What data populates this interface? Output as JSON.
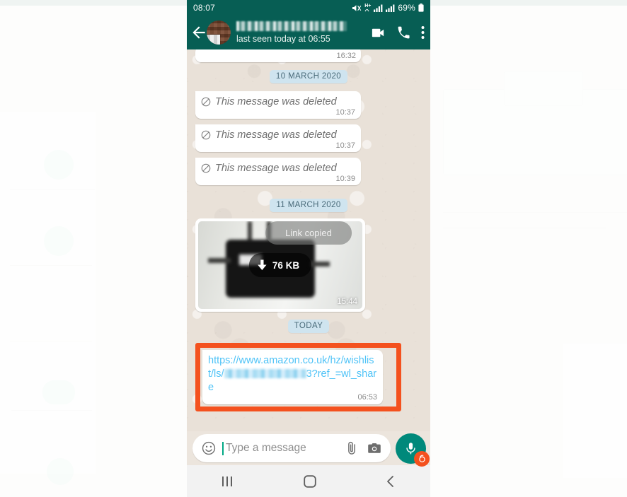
{
  "status_bar": {
    "clock": "08:07",
    "network_label": "H+",
    "battery_percent": "69%",
    "icons": [
      "mute-icon",
      "network-hplus-icon",
      "signal-bars-icon",
      "signal-bars-2-icon",
      "battery-icon"
    ]
  },
  "app_bar": {
    "back_label": "back-arrow-icon",
    "contact_name": "",
    "status_text": "last seen today at 06:55",
    "actions": [
      {
        "name": "video-call-button",
        "label": "Video call"
      },
      {
        "name": "voice-call-button",
        "label": "Voice call"
      },
      {
        "name": "overflow-menu-button",
        "label": "More options"
      }
    ]
  },
  "chat": {
    "toast": "Link copied",
    "top_partial_bubble": {
      "time": "16:32"
    },
    "dividers": {
      "first": "10 MARCH 2020",
      "second": "11 MARCH 2020",
      "third": "TODAY"
    },
    "deleted_messages": [
      {
        "text": "This message was deleted",
        "time": "10:37"
      },
      {
        "text": "This message was deleted",
        "time": "10:37"
      },
      {
        "text": "This message was deleted",
        "time": "10:39"
      }
    ],
    "image_message": {
      "download_size": "76 KB",
      "time": "15:44"
    },
    "link_message": {
      "url_part1": "https://www.amazon.co.uk/hz",
      "url_part2": "/wishlist/ls/",
      "url_redacted": "",
      "url_part3": "3?ref_",
      "url_part4": "=wl_share",
      "time": "06:53",
      "highlight_color": "#f4511e"
    }
  },
  "input_bar": {
    "placeholder": "Type a message",
    "emoji_icon": "emoji-smiley-icon",
    "attach_icon": "paperclip-icon",
    "camera_icon": "camera-icon",
    "mic_icon": "microphone-icon",
    "mic_badge_icon": "record-badge-icon"
  },
  "nav_bar": {
    "recents": "recents-button",
    "home": "home-button",
    "back": "back-button"
  },
  "colors": {
    "whatsapp_header": "#075e54",
    "highlight_orange": "#f4511e",
    "link_blue": "#4fc3f7",
    "date_chip": "#cfe4ef",
    "mic_green": "#00897b"
  }
}
